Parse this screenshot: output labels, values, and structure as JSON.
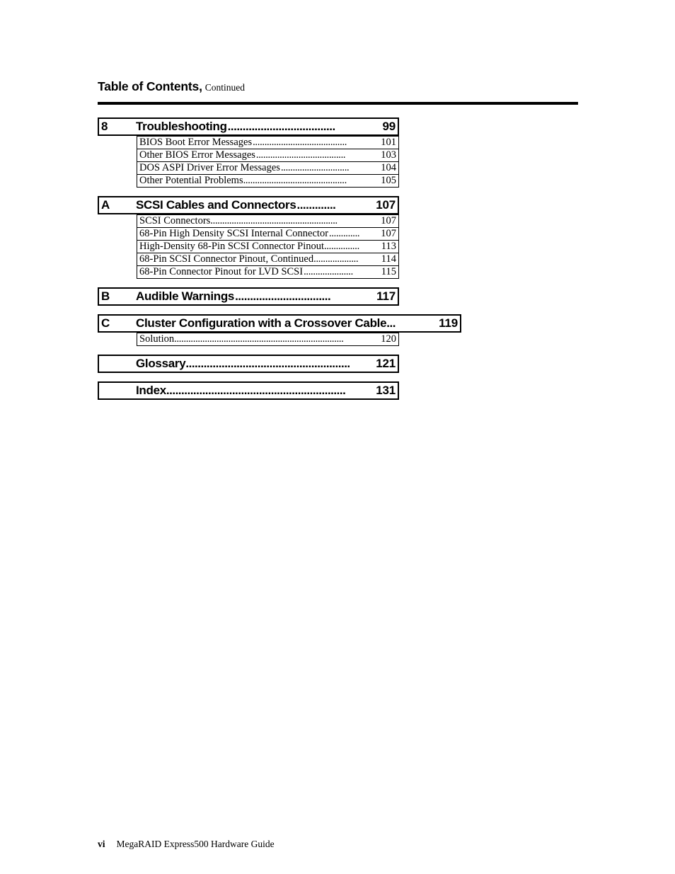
{
  "header": {
    "title": "Table of Contents,",
    "continued": "Continued"
  },
  "toc": {
    "groups": [
      {
        "number": "8",
        "title": "Troubleshooting",
        "leader": "....................................",
        "page": "99",
        "width": "normal",
        "tight": false,
        "entries": [
          {
            "title": "BIOS Boot Error Messages",
            "leader": "........................................",
            "page": "101",
            "tight": false
          },
          {
            "title": "Other BIOS Error Messages",
            "leader": "......................................",
            "page": "103",
            "tight": false
          },
          {
            "title": "DOS ASPI Driver Error Messages",
            "leader": ".............................",
            "page": "104",
            "tight": false
          },
          {
            "title": "Other Potential Problems",
            "leader": "............................................",
            "page": "105",
            "tight": true
          }
        ]
      },
      {
        "number": "A",
        "title": "SCSI Cables and Connectors",
        "leader": ".............",
        "page": "107",
        "width": "normal",
        "tight": false,
        "entries": [
          {
            "title": "SCSI Connectors",
            "leader": "......................................................",
            "page": "107",
            "tight": true
          },
          {
            "title": "68-Pin High Density SCSI Internal Connector",
            "leader": ".............",
            "page": "107",
            "tight": false
          },
          {
            "title": "High-Density 68-Pin SCSI Connector Pinout",
            "leader": "...............",
            "page": "113",
            "tight": true
          },
          {
            "title": "68-Pin SCSI Connector Pinout, Continued",
            "leader": "...................",
            "page": "114",
            "tight": true
          },
          {
            "title": "68-Pin Connector Pinout for LVD SCSI",
            "leader": ".....................",
            "page": "115",
            "tight": false
          }
        ]
      },
      {
        "number": "B",
        "title": "Audible Warnings",
        "leader": "................................",
        "page": "117",
        "width": "normal",
        "tight": false,
        "entries": []
      },
      {
        "number": "C",
        "title": "Cluster Configuration with a Crossover Cable",
        "leader": "...",
        "page": "119",
        "width": "wide",
        "tight": true,
        "entries": [
          {
            "title": "Solution",
            "leader": "........................................................................",
            "page": "120",
            "tight": true
          }
        ]
      },
      {
        "number": "",
        "title": "Glossary",
        "leader": ".......................................................",
        "page": "121",
        "width": "normal",
        "tight": true,
        "entries": []
      },
      {
        "number": "",
        "title": "Index",
        "leader": "............................................................",
        "page": "131",
        "width": "normal",
        "tight": true,
        "entries": []
      }
    ]
  },
  "footer": {
    "page_number": "vi",
    "document_title": "MegaRAID Express500 Hardware Guide"
  }
}
